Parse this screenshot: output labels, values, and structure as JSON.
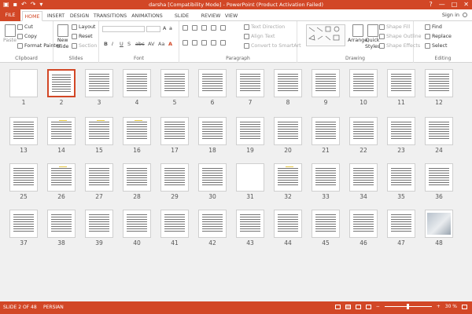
{
  "titlebar": {
    "title": "darsha [Compatibility Mode] - PowerPoint (Product Activation Failed)",
    "help_glyph": "?",
    "min_glyph": "—",
    "max_glyph": "□",
    "close_glyph": "✕",
    "qat_icons": [
      "app-icon",
      "save-icon",
      "undo-icon",
      "redo-icon",
      "customize-icon"
    ]
  },
  "tabs": [
    {
      "label": "FILE"
    },
    {
      "label": "HOME"
    },
    {
      "label": "INSERT"
    },
    {
      "label": "DESIGN"
    },
    {
      "label": "TRANSITIONS"
    },
    {
      "label": "ANIMATIONS"
    },
    {
      "label": "SLIDE SHOW"
    },
    {
      "label": "REVIEW"
    },
    {
      "label": "VIEW"
    }
  ],
  "signin": "Sign in",
  "ribbon": {
    "clipboard": {
      "label": "Clipboard",
      "paste": "Paste",
      "cut": "Cut",
      "copy": "Copy",
      "format_painter": "Format Painter"
    },
    "slides": {
      "label": "Slides",
      "new_slide": "New",
      "new_slide2": "Slide",
      "layout": "Layout",
      "reset": "Reset",
      "section": "Section"
    },
    "font": {
      "label": "Font",
      "bold": "B",
      "italic": "I",
      "underline": "U",
      "shadow": "S",
      "strike": "abc",
      "spacing": "AV",
      "case": "Aa",
      "color": "A"
    },
    "paragraph": {
      "label": "Paragraph",
      "text_direction": "Text Direction",
      "align_text": "Align Text",
      "convert_smartart": "Convert to SmartArt"
    },
    "drawing": {
      "label": "Drawing",
      "arrange": "Arrange",
      "quick_styles": "Quick",
      "quick_styles2": "Styles",
      "shape_fill": "Shape Fill",
      "shape_outline": "Shape Outline",
      "shape_effects": "Shape Effects"
    },
    "editing": {
      "label": "Editing",
      "find": "Find",
      "replace": "Replace",
      "select": "Select"
    }
  },
  "slides_row1": [
    {
      "num": "12"
    },
    {
      "num": "11"
    },
    {
      "num": "10"
    },
    {
      "num": "9"
    },
    {
      "num": "8"
    },
    {
      "num": "7"
    },
    {
      "num": "6"
    },
    {
      "num": "5"
    },
    {
      "num": "4"
    },
    {
      "num": "3"
    },
    {
      "num": "2"
    },
    {
      "num": "1"
    }
  ],
  "slides_row2": [
    {
      "num": "24"
    },
    {
      "num": "23"
    },
    {
      "num": "22"
    },
    {
      "num": "21"
    },
    {
      "num": "20"
    },
    {
      "num": "19"
    },
    {
      "num": "18"
    },
    {
      "num": "17"
    },
    {
      "num": "16"
    },
    {
      "num": "15"
    },
    {
      "num": "14"
    },
    {
      "num": "13"
    }
  ],
  "slides_row3": [
    {
      "num": "36"
    },
    {
      "num": "35"
    },
    {
      "num": "34"
    },
    {
      "num": "33"
    },
    {
      "num": "32"
    },
    {
      "num": "31"
    },
    {
      "num": "30"
    },
    {
      "num": "29"
    },
    {
      "num": "28"
    },
    {
      "num": "27"
    },
    {
      "num": "26"
    },
    {
      "num": "25"
    }
  ],
  "slides_row4": [
    {
      "num": "48"
    },
    {
      "num": "47"
    },
    {
      "num": "46"
    },
    {
      "num": "45"
    },
    {
      "num": "44"
    },
    {
      "num": "43"
    },
    {
      "num": "42"
    },
    {
      "num": "41"
    },
    {
      "num": "40"
    },
    {
      "num": "39"
    },
    {
      "num": "38"
    },
    {
      "num": "37"
    }
  ],
  "selected_slide": "2",
  "status": {
    "slide": "SLIDE 2 OF 48",
    "language": "PERSIAN",
    "zoom": "30 %",
    "zoom_minus": "−",
    "zoom_plus": "+",
    "view_icons": [
      "normal-view-icon",
      "slide-sorter-view-icon",
      "reading-view-icon",
      "slideshow-view-icon"
    ]
  },
  "colors": {
    "accent": "#d24726",
    "selection": "#d24726"
  }
}
